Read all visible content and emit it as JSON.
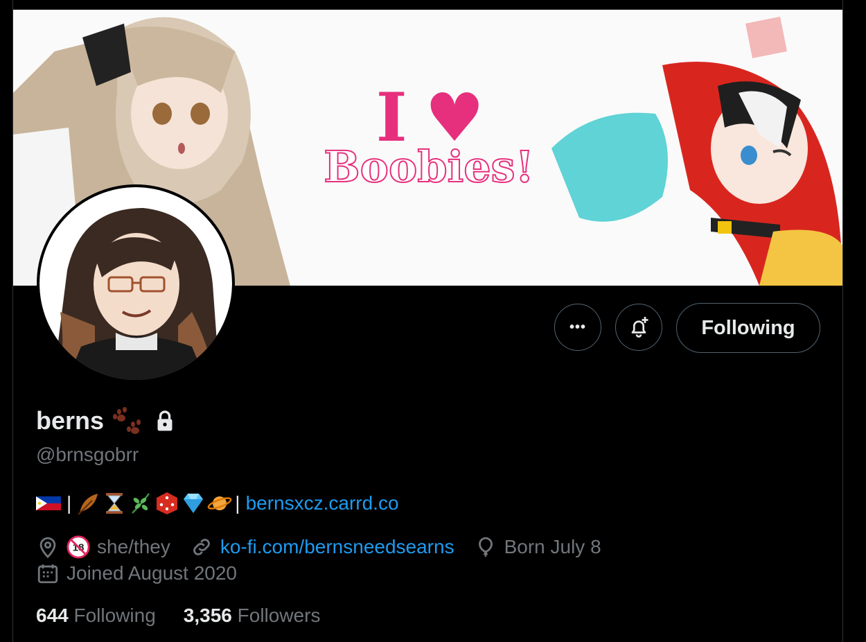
{
  "banner": {
    "line1": "I ♥",
    "line2": "Boobies!"
  },
  "actions": {
    "more_label": "•••",
    "following_label": "Following"
  },
  "profile": {
    "display_name": "berns",
    "handle": "@brnsgobrr",
    "bio_link": "bernsxcz.carrd.co",
    "bio_separator_left": "|",
    "bio_separator_right": "|",
    "location": "she/they",
    "website": "ko-fi.com/bernsneedsearns",
    "birthday": "Born July 8",
    "joined": "Joined August 2020"
  },
  "stats": {
    "following_count": "644",
    "following_label": "Following",
    "followers_count": "3,356",
    "followers_label": "Followers"
  },
  "colors": {
    "link": "#1d9bf0",
    "muted": "#71767b",
    "text": "#e7e9ea",
    "banner_text": "#e6307d"
  },
  "icons": [
    "paw-prints-icon",
    "lock-icon",
    "flag-ph-icon",
    "feather-icon",
    "hourglass-icon",
    "herb-icon",
    "die-icon",
    "gem-icon",
    "planet-icon",
    "location-pin-icon",
    "no-18-icon",
    "link-icon",
    "balloon-icon",
    "calendar-icon",
    "more-icon",
    "bell-plus-icon"
  ]
}
